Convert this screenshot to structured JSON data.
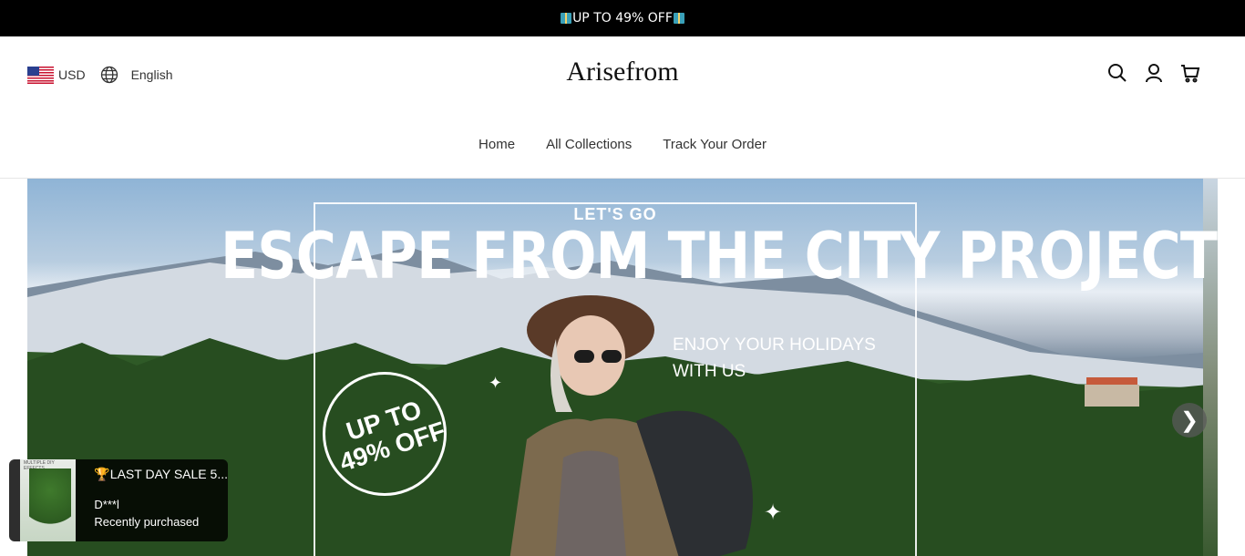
{
  "announcement": {
    "text": "UP TO 49% OFF",
    "icon": "gift-icon"
  },
  "header": {
    "currency": "USD",
    "language": "English",
    "logo": "Arisefrom",
    "icons": [
      "search-icon",
      "account-icon",
      "cart-icon"
    ]
  },
  "nav": {
    "items": [
      {
        "label": "Home"
      },
      {
        "label": "All Collections"
      },
      {
        "label": "Track Your Order"
      }
    ]
  },
  "hero": {
    "eyebrow": "LET'S GO",
    "title": "ESCAPE FROM THE CITY PROJECT",
    "subtitle_line1": "ENJOY YOUR HOLIDAYS",
    "subtitle_line2": "WITH US",
    "badge_line1": "UP TO",
    "badge_line2": "49% OFF",
    "next_arrow": "❯"
  },
  "popup": {
    "thumb_caption": "MULTIPLE DIY EFFECTS",
    "title": "🏆LAST DAY SALE 5...",
    "name": "D***l",
    "status": "Recently purchased"
  },
  "colors": {
    "announce_bg": "#000000",
    "text": "#222222"
  }
}
